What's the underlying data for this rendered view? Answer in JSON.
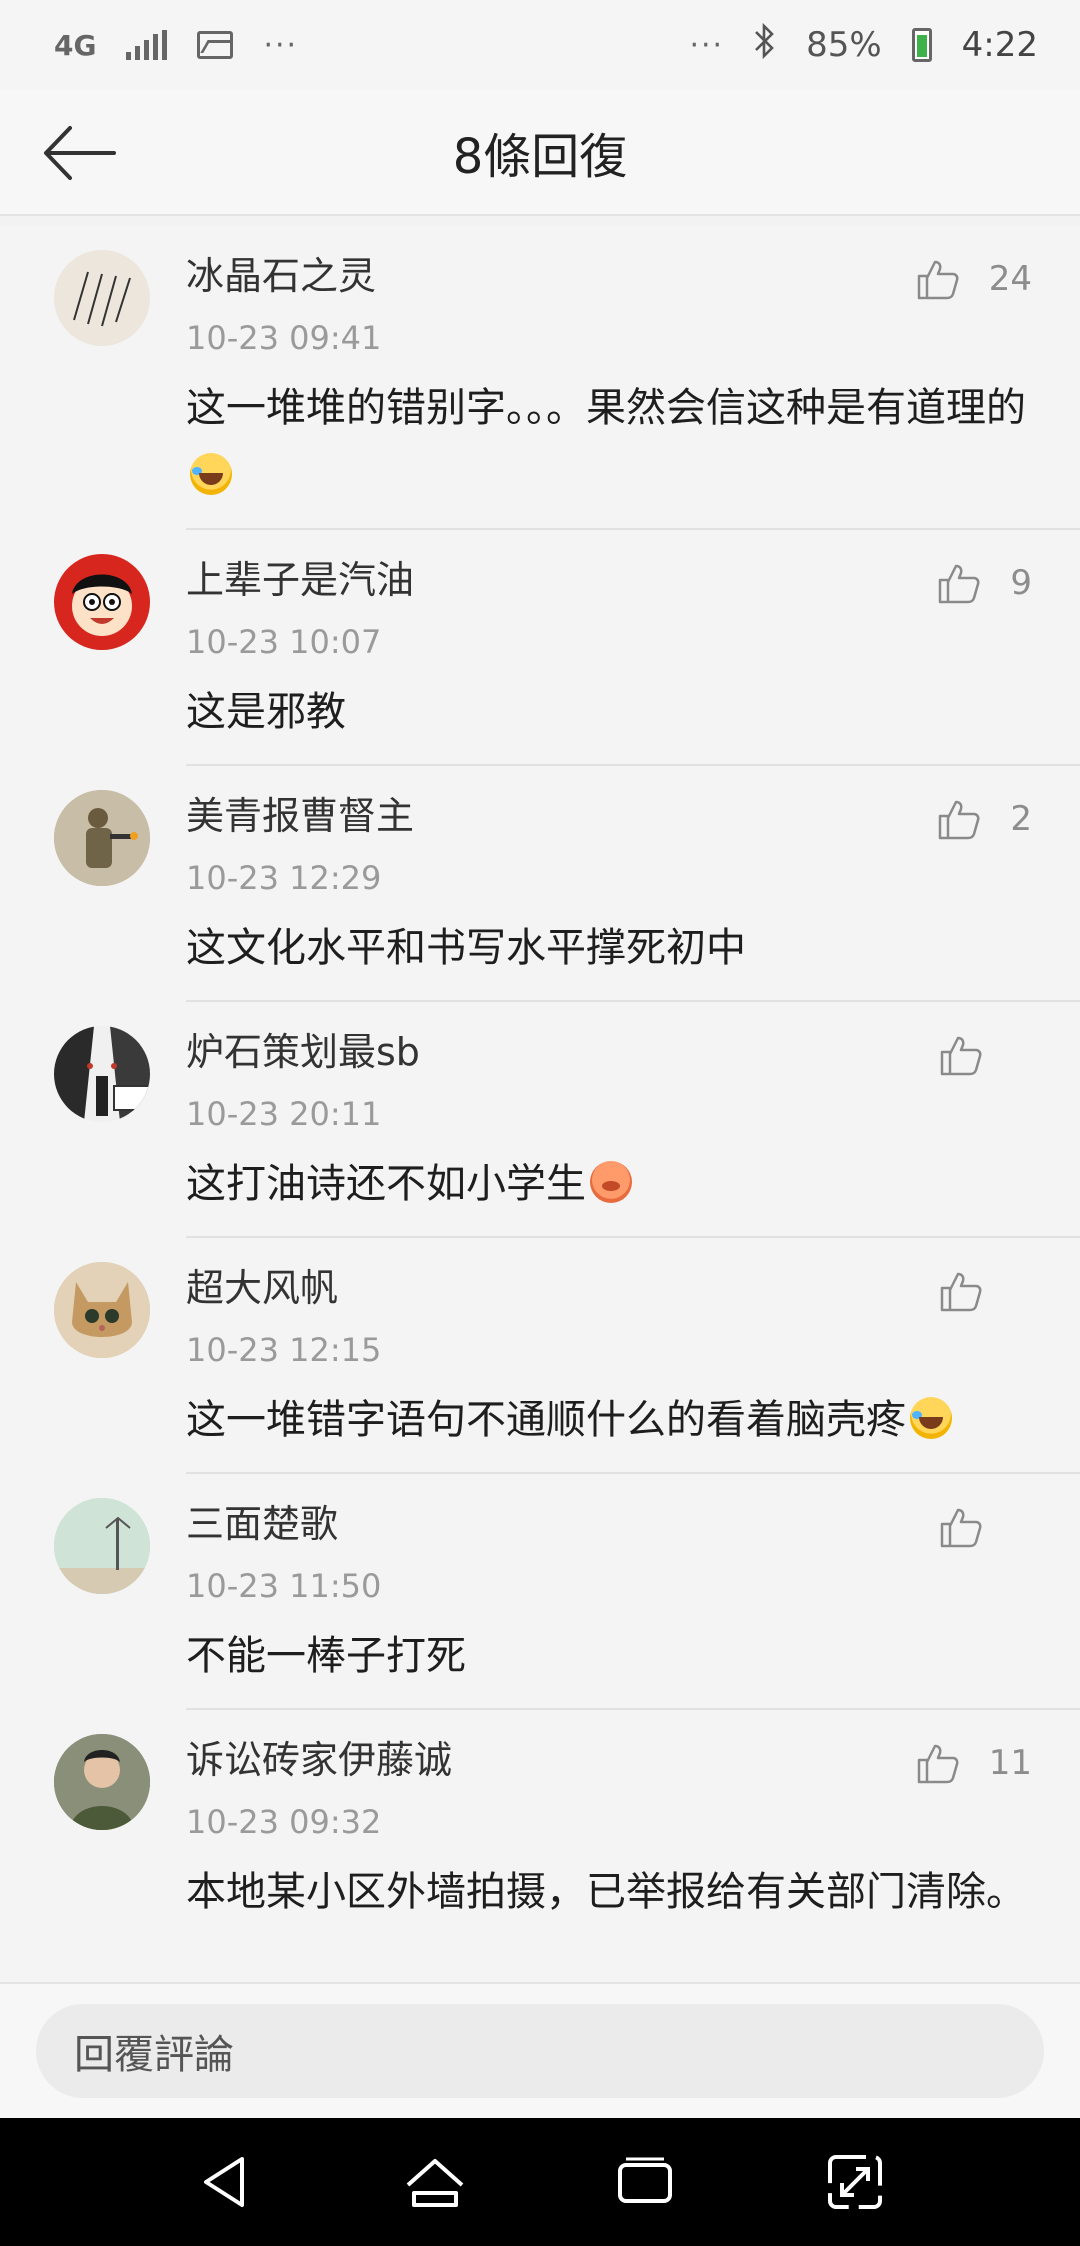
{
  "status_bar": {
    "network": "4G",
    "dots_left": "···",
    "dots_right": "···",
    "battery": "85%",
    "time": "4:22"
  },
  "header": {
    "title": "8條回復"
  },
  "comments": [
    {
      "name": "冰晶石之灵",
      "time": "10-23 09:41",
      "text": "这一堆堆的错别字。。。果然会信这种是有道理的",
      "likes": "24"
    },
    {
      "name": "上辈子是汽油",
      "time": "10-23 10:07",
      "text": "这是邪教",
      "likes": "9"
    },
    {
      "name": "美青报曹督主",
      "time": "10-23 12:29",
      "text": "这文化水平和书写水平撑死初中",
      "likes": "2"
    },
    {
      "name": "炉石策划最sb",
      "time": "10-23 20:11",
      "text": "这打油诗还不如小学生",
      "likes": ""
    },
    {
      "name": "超大风帆",
      "time": "10-23 12:15",
      "text": "这一堆错字语句不通顺什么的看着脑壳疼",
      "likes": ""
    },
    {
      "name": "三面楚歌",
      "time": "10-23 11:50",
      "text": "不能一棒子打死",
      "likes": ""
    },
    {
      "name": "诉讼砖家伊藤诚",
      "time": "10-23 09:32",
      "text": "本地某小区外墙拍摄，已举报给有关部门清除。",
      "likes": "11"
    }
  ],
  "reply_bar": {
    "placeholder": "回覆評論"
  }
}
